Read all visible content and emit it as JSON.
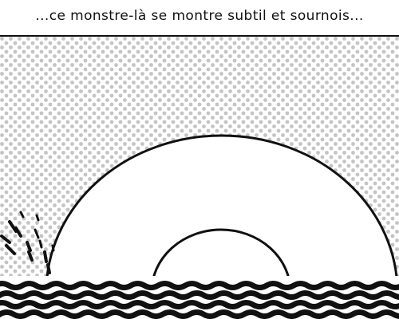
{
  "caption": {
    "text": "...ce monstre-là se montre subtil et sournois..."
  },
  "panel": {
    "icons": [
      "rainbow-arch-icon",
      "ocean-waves-icon",
      "water-splash-icon"
    ]
  },
  "colors": {
    "ink": "#111111",
    "paper": "#ffffff",
    "halftone": "#c4c4c4"
  }
}
